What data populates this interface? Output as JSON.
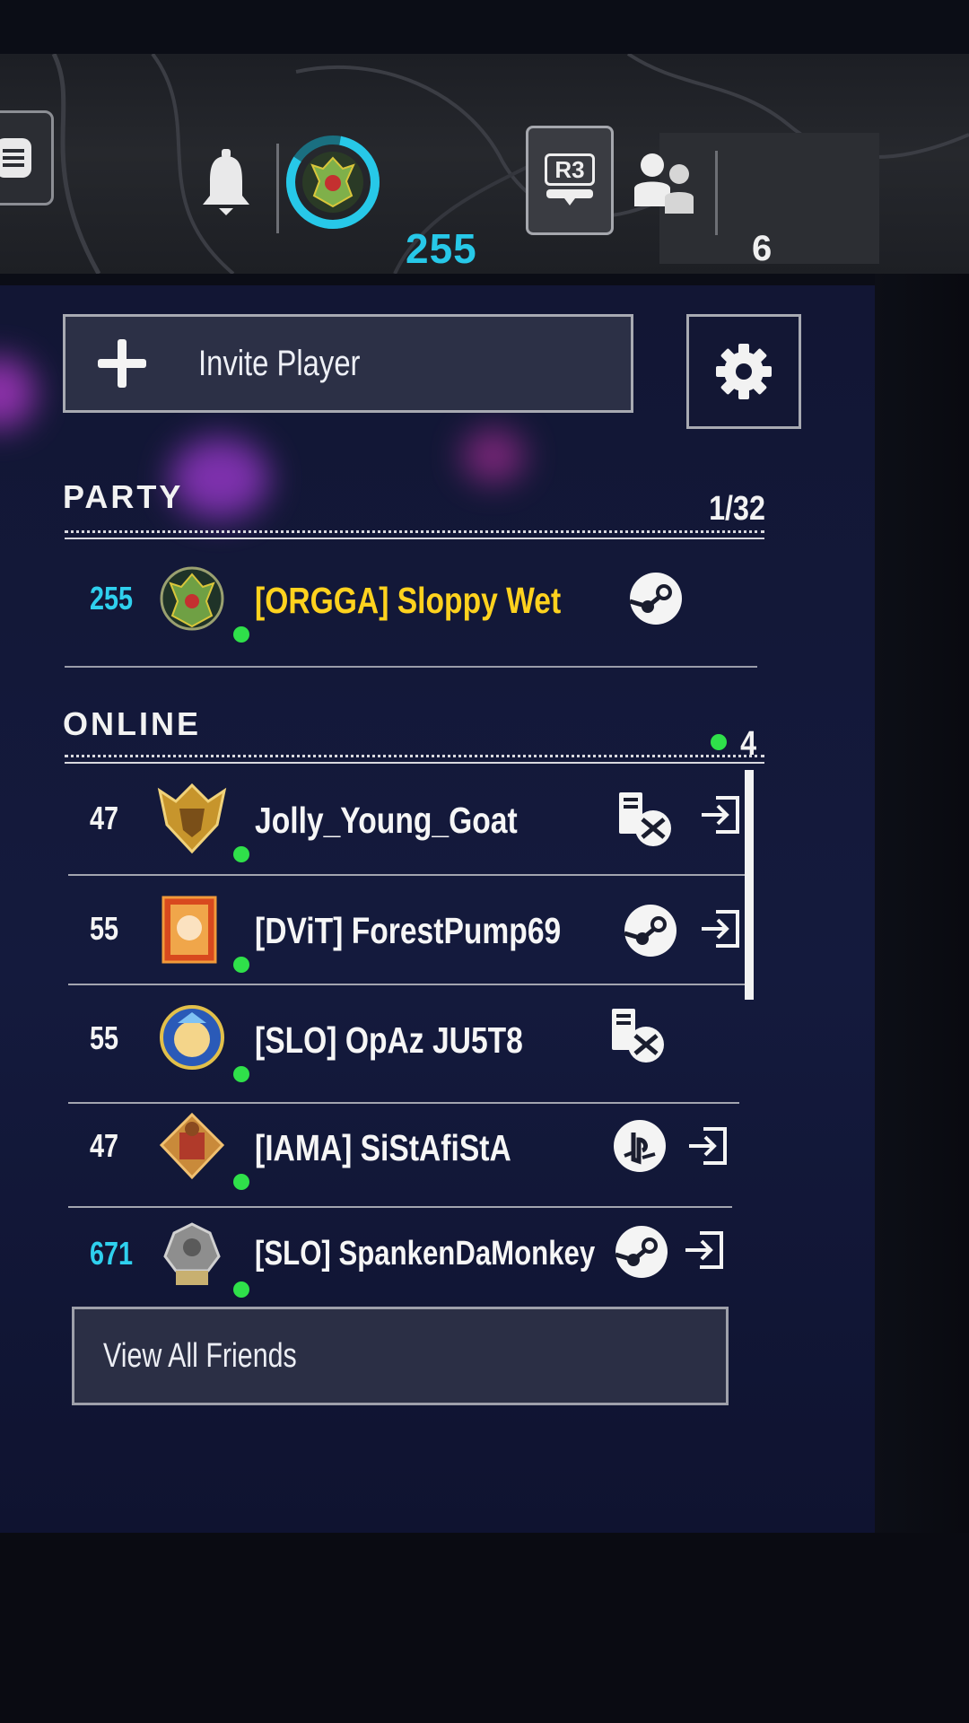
{
  "topbar": {
    "player_level": "255",
    "r3_label": "R3",
    "friends_count": "6"
  },
  "panel": {
    "invite_label": "Invite Player",
    "party": {
      "title": "PARTY",
      "count": "1/32",
      "members": [
        {
          "level": "255",
          "level_color": "#2fd0ee",
          "name": "[ORGGA] Sloppy Wet",
          "name_color": "#ffd21e",
          "platform": "steam-icon"
        }
      ]
    },
    "online": {
      "title": "ONLINE",
      "count": "4",
      "friends": [
        {
          "level": "47",
          "name": "Jolly_Young_Goat",
          "platform": "xbox-pc-icon",
          "join": "join-icon"
        },
        {
          "level": "55",
          "name": "[DViT] ForestPump69",
          "platform": "steam-icon",
          "join": "join-icon"
        },
        {
          "level": "55",
          "name": "[SLO] OpAz JU5T8",
          "platform": "xbox-pc-icon"
        },
        {
          "level": "47",
          "name": "[IAMA] SiStAfiStA",
          "platform": "playstation-icon",
          "join": "join-icon"
        },
        {
          "level": "671",
          "level_color": "#2fd0ee",
          "name": "[SLO] SpankenDaMonkey",
          "platform": "steam-icon",
          "join": "join-icon"
        }
      ]
    },
    "view_all_label": "View All Friends"
  },
  "colors": {
    "accent_cyan": "#27c8e8",
    "online_green": "#2fe04a",
    "party_name_gold": "#ffd21e",
    "panel_bg": "#141a3d"
  }
}
